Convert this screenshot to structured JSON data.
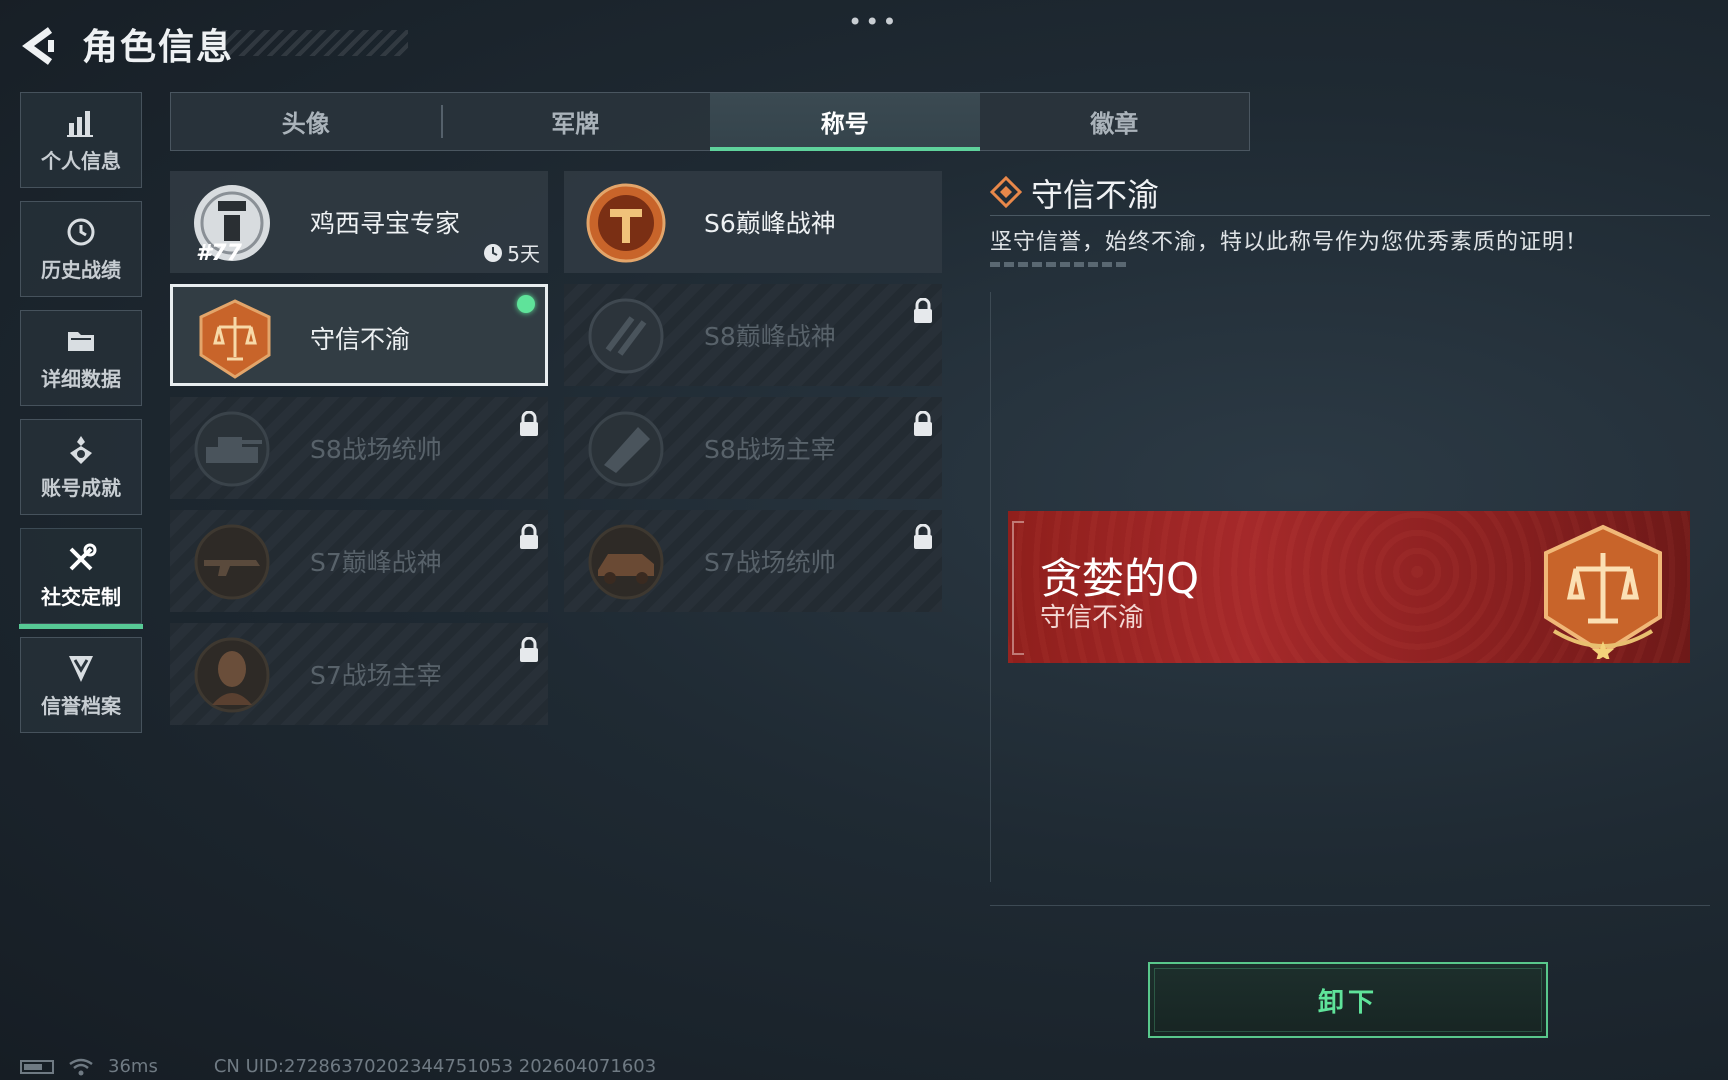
{
  "header": {
    "title": "角色信息",
    "menu_dots": "•••"
  },
  "sidebar": {
    "items": [
      {
        "label": "个人信息",
        "icon": "bar-chart-icon",
        "active": false
      },
      {
        "label": "历史战绩",
        "icon": "history-clock-icon",
        "active": false
      },
      {
        "label": "详细数据",
        "icon": "folder-icon",
        "active": false
      },
      {
        "label": "账号成就",
        "icon": "medal-icon",
        "active": false
      },
      {
        "label": "社交定制",
        "icon": "tools-icon",
        "active": true
      },
      {
        "label": "信誉档案",
        "icon": "shield-chevron-icon",
        "active": false
      }
    ]
  },
  "tabs": [
    {
      "label": "头像",
      "active": false
    },
    {
      "label": "军牌",
      "active": false
    },
    {
      "label": "称号",
      "active": true
    },
    {
      "label": "徽章",
      "active": false
    }
  ],
  "titles": [
    {
      "name": "鸡西寻宝专家",
      "badge_number": "#77",
      "timer": "5天",
      "locked": false,
      "selected": false
    },
    {
      "name": "S6巅峰战神",
      "locked": false,
      "selected": false
    },
    {
      "name": "守信不渝",
      "locked": false,
      "selected": true,
      "equipped": true
    },
    {
      "name": "S8巅峰战神",
      "locked": true,
      "selected": false
    },
    {
      "name": "S8战场统帅",
      "locked": true,
      "selected": false
    },
    {
      "name": "S8战场主宰",
      "locked": true,
      "selected": false
    },
    {
      "name": "S7巅峰战神",
      "locked": true,
      "selected": false
    },
    {
      "name": "S7战场统帅",
      "locked": true,
      "selected": false
    },
    {
      "name": "S7战场主宰",
      "locked": true,
      "selected": false
    }
  ],
  "detail": {
    "title": "守信不渝",
    "description": "坚守信誉，始终不渝，特以此称号作为您优秀素质的证明！",
    "preview": {
      "player_name": "贪婪的Q",
      "title": "守信不渝"
    },
    "unequip_label": "卸下"
  },
  "status_bar": {
    "ping": "36ms",
    "uid": "CN UID:27286370202344751053 202604071603"
  },
  "colors": {
    "accent_green": "#5fd29c",
    "banner_red": "#a5292a",
    "badge_orange": "#c8642a"
  }
}
